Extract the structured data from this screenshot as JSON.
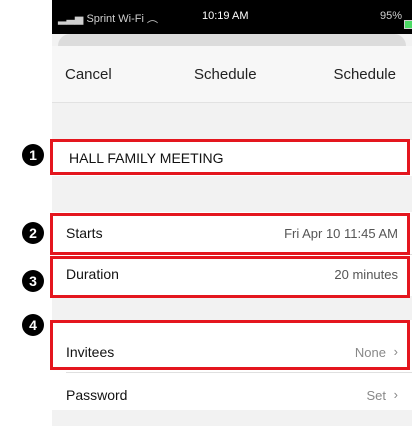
{
  "status_bar": {
    "carrier": "Sprint Wi-Fi",
    "time": "10:19 AM",
    "battery": "95%"
  },
  "nav": {
    "cancel": "Cancel",
    "title": "Schedule",
    "action": "Schedule"
  },
  "meeting": {
    "topic": "HALL FAMILY MEETING"
  },
  "rows": {
    "starts": {
      "label": "Starts",
      "value": "Fri Apr 10 11:45 AM"
    },
    "duration": {
      "label": "Duration",
      "value": "20 minutes"
    },
    "invitees": {
      "label": "Invitees",
      "value": "None"
    },
    "password": {
      "label": "Password",
      "value": "Set"
    }
  },
  "callouts": [
    "1",
    "2",
    "3",
    "4"
  ],
  "colors": {
    "callout_border": "#e4161e",
    "badge_bg": "#000000"
  }
}
